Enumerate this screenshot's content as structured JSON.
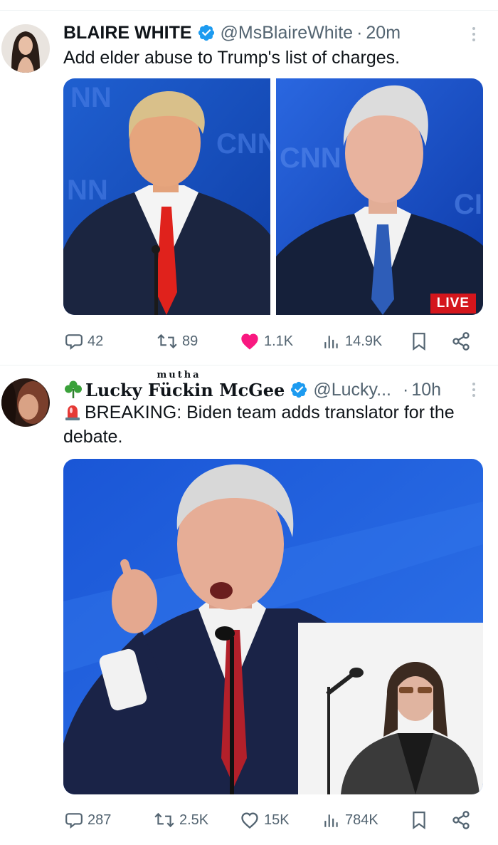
{
  "post1": {
    "author_name": "BLAIRE WHITE",
    "handle": "@MsBlaireWhite",
    "separator": "·",
    "time": "20m",
    "text": "Add elder abuse to Trump's list of charges.",
    "live_badge": "LIVE",
    "stats": {
      "replies": "42",
      "reposts": "89",
      "likes": "1.1K",
      "views": "14.9K"
    },
    "liked": true
  },
  "post2": {
    "author_prefix_icon": "shamrock-emoji",
    "author_name_1": "Lucky F",
    "author_name_2": "ckin",
    "author_name_3": " McGee",
    "author_superscript": "mutha",
    "handle": "@Lucky...",
    "separator": "·",
    "time": "10h",
    "text_icon": "siren-emoji",
    "text": "BREAKING: Biden team adds translator for the debate.",
    "stats": {
      "replies": "287",
      "reposts": "2.5K",
      "likes": "15K",
      "views": "784K"
    },
    "liked": false
  },
  "colors": {
    "verified": "#1d9bf0",
    "like": "#f91880",
    "meta": "#536471",
    "live": "#d4161c"
  }
}
